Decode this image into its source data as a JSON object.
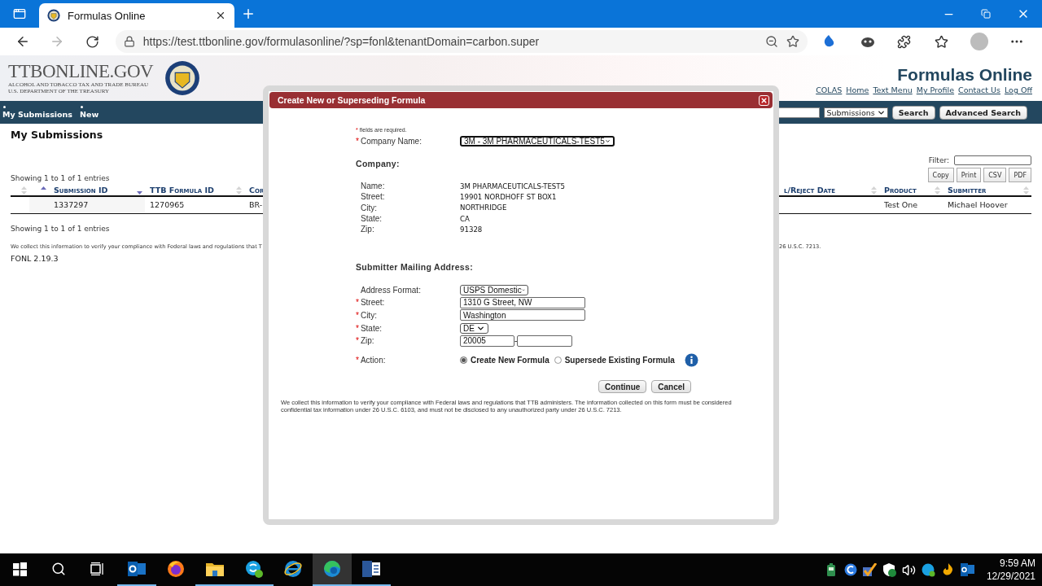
{
  "browser": {
    "tab_title": "Formulas Online",
    "address": "https://test.ttbonline.gov/formulasonline/?sp=fonl&tenantDomain=carbon.super",
    "forward_disabled": true
  },
  "header": {
    "logo": "TTBONLINE.GOV",
    "agency": "ALCOHOL AND TOBACCO TAX AND TRADE BUREAU",
    "department": "U.S. DEPARTMENT OF THE TREASURY",
    "site_title": "Formulas Online",
    "links": [
      "COLAS",
      "Home",
      "Text Menu",
      "My Profile",
      "Contact Us",
      "Log Off"
    ]
  },
  "nav": {
    "items": [
      "My Submissions",
      "New"
    ],
    "search_scope": "Submissions",
    "buttons": [
      "Search",
      "Advanced Search"
    ]
  },
  "page": {
    "heading": "My Submissions",
    "filter_label": "Filter:",
    "export_buttons": [
      "Copy",
      "Print",
      "CSV",
      "PDF"
    ],
    "info_top": "Showing 1 to 1 of 1 entries",
    "info_bottom": "Showing 1 to 1 of 1 entries",
    "table": {
      "columns": [
        {
          "sorted_asc": false,
          "sorted_desc": false
        },
        {
          "sorted_asc": true,
          "sorted_desc": false
        },
        {
          "label": "Submission ID",
          "sorted_asc": false,
          "sorted_desc": true
        },
        {
          "label": "TTB Formula ID",
          "sorted_asc": false,
          "sorted_desc": false
        },
        {
          "label": "Cor"
        },
        {
          "label": "l/Reject Date",
          "sorted_asc": false,
          "sorted_desc": false
        },
        {
          "label": "Product",
          "sorted_asc": false,
          "sorted_desc": false
        },
        {
          "label": "Submitter",
          "sorted_asc": false,
          "sorted_desc": false
        }
      ],
      "rows": [
        {
          "cells": [
            null,
            null,
            "1337297",
            "1270965",
            "BR-",
            null,
            "Test One",
            "Michael Hoover"
          ]
        }
      ]
    },
    "notice_left": "We collect this information to verify your compliance with Federal laws and regulations that T",
    "notice_right": "26 U.S.C. 7213.",
    "version": "FONL 2.19.3"
  },
  "modal": {
    "title": "Create New or Superseding Formula",
    "required_mark": "*",
    "required_note": "fields are required.",
    "company_name": {
      "label": "Company Name:",
      "value": "3M - 3M PHARMACEUTICALS-TEST5",
      "required": true
    },
    "company_heading": "Company:",
    "company_details": [
      {
        "label": "Name:",
        "value": "3M PHARMACEUTICALS-TEST5"
      },
      {
        "label": "Street:",
        "value": "19901 NORDHOFF ST BOX1"
      },
      {
        "label": "City:",
        "value": "NORTHRIDGE"
      },
      {
        "label": "State:",
        "value": "CA"
      },
      {
        "label": "Zip:",
        "value": "91328"
      }
    ],
    "mailing_heading": "Submitter Mailing Address:",
    "fields": [
      {
        "kind": "select",
        "label": "Address Format:",
        "value": "USPS Domestic",
        "required": false
      },
      {
        "kind": "text",
        "label": "Street:",
        "value": "1310 G Street, NW",
        "required": true
      },
      {
        "kind": "text",
        "label": "City:",
        "value": "Washington",
        "required": true
      },
      {
        "kind": "select",
        "label": "State:",
        "value": "DE",
        "required": true
      },
      {
        "kind": "zip",
        "label": "Zip:",
        "value": "20005",
        "separator": "-",
        "required": true
      }
    ],
    "action": {
      "label": "Action:",
      "required": true,
      "options": [
        {
          "label": "Create New Formula",
          "selected": true
        },
        {
          "label": "Supersede Existing Formula",
          "selected": false
        }
      ]
    },
    "buttons": [
      "Continue",
      "Cancel"
    ],
    "notice": "We collect this information to verify your compliance with Federal laws and regulations that TTB administers. The information collected on this form must be considered confidential tax information under 26 U.S.C. 6103, and must not be disclosed to any unauthorized party under 26 U.S.C. 7213."
  },
  "taskbar": {
    "apps": [
      {
        "kind": "outlook",
        "running": true,
        "selected": false
      },
      {
        "kind": "firefox",
        "running": false,
        "selected": false
      },
      {
        "kind": "explorer",
        "running": true,
        "selected": false
      },
      {
        "kind": "skype",
        "running": true,
        "selected": false
      },
      {
        "kind": "ie",
        "running": false,
        "selected": false
      },
      {
        "kind": "edge",
        "running": true,
        "selected": true
      },
      {
        "kind": "word",
        "running": true,
        "selected": false
      }
    ],
    "time": "9:59 AM",
    "date": "12/29/2021"
  }
}
